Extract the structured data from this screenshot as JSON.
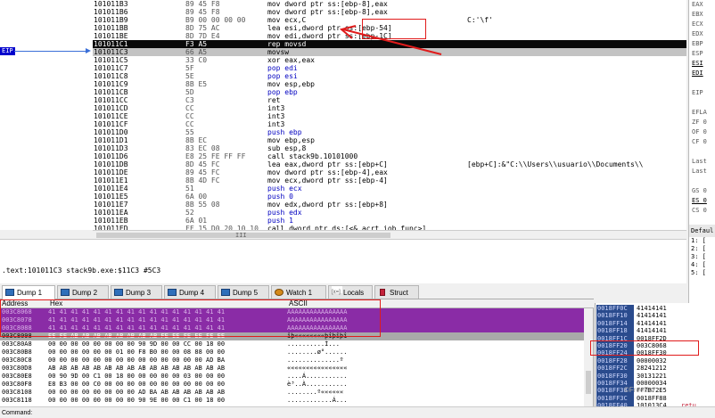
{
  "eip_label": "EIP",
  "disasm": [
    {
      "addr": "101011B3",
      "bytes": "89 45 F8",
      "instr": "mov dword ptr ss:[ebp-8],eax",
      "cmt": ""
    },
    {
      "addr": "101011B6",
      "bytes": "89 45 F8",
      "instr": "mov dword ptr ss:[ebp-8],eax",
      "cmt": ""
    },
    {
      "addr": "101011B9",
      "bytes": "B9 00 00 00 00",
      "instr": "mov ecx,C",
      "cmt": "C:'\\f'"
    },
    {
      "addr": "101011BB",
      "bytes": "8D 75 AC",
      "instr": "lea esi,dword ptr ss:[ebp-54]",
      "cmt": ""
    },
    {
      "addr": "101011BE",
      "bytes": "8D 7D E4",
      "instr": "mov edi,dword ptr ss:[ebp-1C]",
      "cmt": ""
    },
    {
      "addr": "101011C1",
      "bytes": "F3 A5",
      "instr": "rep movsd",
      "cmt": ""
    },
    {
      "addr": "101011C3",
      "bytes": "66 A5",
      "instr": "movsw",
      "cmt": ""
    },
    {
      "addr": "101011C5",
      "bytes": "33 C0",
      "instr": "xor eax,eax",
      "cmt": ""
    },
    {
      "addr": "101011C7",
      "bytes": "5F",
      "instr": "pop edi",
      "cmt": ""
    },
    {
      "addr": "101011C8",
      "bytes": "5E",
      "instr": "pop esi",
      "cmt": ""
    },
    {
      "addr": "101011C9",
      "bytes": "8B E5",
      "instr": "mov esp,ebp",
      "cmt": ""
    },
    {
      "addr": "101011CB",
      "bytes": "5D",
      "instr": "pop ebp",
      "cmt": ""
    },
    {
      "addr": "101011CC",
      "bytes": "C3",
      "instr": "ret",
      "cmt": ""
    },
    {
      "addr": "101011CD",
      "bytes": "CC",
      "instr": "int3",
      "cmt": ""
    },
    {
      "addr": "101011CE",
      "bytes": "CC",
      "instr": "int3",
      "cmt": ""
    },
    {
      "addr": "101011CF",
      "bytes": "CC",
      "instr": "int3",
      "cmt": ""
    },
    {
      "addr": "101011D0",
      "bytes": "55",
      "instr": "push ebp",
      "cmt": ""
    },
    {
      "addr": "101011D1",
      "bytes": "8B EC",
      "instr": "mov ebp,esp",
      "cmt": ""
    },
    {
      "addr": "101011D3",
      "bytes": "83 EC 08",
      "instr": "sub esp,8",
      "cmt": ""
    },
    {
      "addr": "101011D6",
      "bytes": "E8 25 FE FF FF",
      "instr": "call stack9b.10101000",
      "cmt": ""
    },
    {
      "addr": "101011DB",
      "bytes": "8D 45 FC",
      "instr": "lea eax,dword ptr ss:[ebp+C]",
      "cmt": "[ebp+C]:&\"C:\\\\Users\\\\usuario\\\\Documents\\\\"
    },
    {
      "addr": "101011DE",
      "bytes": "89 45 FC",
      "instr": "mov dword ptr ss:[ebp-4],eax",
      "cmt": ""
    },
    {
      "addr": "101011E1",
      "bytes": "8B 4D FC",
      "instr": "mov ecx,dword ptr ss:[ebp-4]",
      "cmt": ""
    },
    {
      "addr": "101011E4",
      "bytes": "51",
      "instr": "push ecx",
      "cmt": ""
    },
    {
      "addr": "101011E5",
      "bytes": "6A 00",
      "instr": "push 0",
      "cmt": ""
    },
    {
      "addr": "101011E7",
      "bytes": "8B 55 08",
      "instr": "mov edx,dword ptr ss:[ebp+8]",
      "cmt": ""
    },
    {
      "addr": "101011EA",
      "bytes": "52",
      "instr": "push edx",
      "cmt": ""
    },
    {
      "addr": "101011EB",
      "bytes": "6A 01",
      "instr": "push 1",
      "cmt": ""
    },
    {
      "addr": "101011ED",
      "bytes": "FF 15 D0 20 10 10",
      "instr": "call dword ptr ds:[<&_acrt_iob_func>]",
      "cmt": ""
    }
  ],
  "registers": [
    "EAX",
    "EBX",
    "ECX",
    "EDX",
    "EBP",
    "ESP",
    "ESI",
    "EDI",
    "",
    "EIP",
    "",
    "EFLA",
    "ZF 0",
    "OF 0",
    "CF 0",
    "",
    "Last",
    "Last",
    "",
    "GS 0",
    "ES 0",
    "CS 0",
    "",
    "x87r",
    "x87r"
  ],
  "def_panel": {
    "header": "Defaul",
    "lines": [
      "1: [",
      "2: [",
      "3: [",
      "4: [",
      "5: ["
    ]
  },
  "info_line": ".text:101011C3 stack9b.exe:$11C3 #5C3",
  "tabs": [
    {
      "label": "Dump 1",
      "icon": "dump-icon"
    },
    {
      "label": "Dump 2",
      "icon": "dump-icon"
    },
    {
      "label": "Dump 3",
      "icon": "dump-icon"
    },
    {
      "label": "Dump 4",
      "icon": "dump-icon"
    },
    {
      "label": "Dump 5",
      "icon": "dump-icon"
    },
    {
      "label": "Watch 1",
      "icon": "watch-icon"
    },
    {
      "label": "Locals",
      "icon": "locals-icon"
    },
    {
      "label": "Struct",
      "icon": "struct-icon"
    }
  ],
  "dump_header": {
    "address": "Address",
    "hex": "Hex",
    "ascii": "ASCII"
  },
  "dump_rows": [
    {
      "addr": "003C8068",
      "hex": "41 41 41 41 41 41 41 41 41 41 41 41 41 41 41 41",
      "ascii": "AAAAAAAAAAAAAAAA",
      "style": "hl"
    },
    {
      "addr": "003C8078",
      "hex": "41 41 41 41 41 41 41 41 41 41 41 41 41 41 41 41",
      "ascii": "AAAAAAAAAAAAAAAA",
      "style": "hl"
    },
    {
      "addr": "003C8088",
      "hex": "41 41 41 41 41 41 41 41 41 41 41 41 41 41 41 41",
      "ascii": "AAAAAAAAAAAAAAAA",
      "style": "hl"
    },
    {
      "addr": "003C8098",
      "hex": "EE FE AB AB AB AB AB AB AB AB FE EE FE EE FE EE",
      "ascii": "îþ««««««««þîþîþî",
      "style": "ef"
    },
    {
      "addr": "003C80A8",
      "hex": "00 00 00 00 00 00 00 00 90 9D 00 00 CC 00 18 00",
      "ascii": "..........Ì...",
      "style": ""
    },
    {
      "addr": "003C80B8",
      "hex": "00 00 00 00 00 00 01 00 F8 B0 00 00 08 88 00 00",
      "ascii": "........ø°......",
      "style": ""
    },
    {
      "addr": "003C80C8",
      "hex": "00 00 00 00 00 00 00 00 00 00 00 00 00 00 AD BA",
      "ascii": "..............­º",
      "style": ""
    },
    {
      "addr": "003C80D8",
      "hex": "AB AB AB AB AB AB AB AB AB AB AB AB AB AB AB AB",
      "ascii": "««««««««««««««««",
      "style": ""
    },
    {
      "addr": "003C80E8",
      "hex": "00 90 9D 00 C1 00 18 00 00 00 00 00 03 00 00 00",
      "ascii": "....Á...........",
      "style": ""
    },
    {
      "addr": "003C80F8",
      "hex": "E8 B3 00 00 C0 00 00 00 00 00 00 00 00 00 00 00",
      "ascii": "è³..À...........",
      "style": ""
    },
    {
      "addr": "003C8108",
      "hex": "00 00 00 00 00 00 00 00 AD BA AB AB AB AB AB AB",
      "ascii": "........­º««««««",
      "style": ""
    },
    {
      "addr": "003C8118",
      "hex": "00 00 00 00 00 00 00 00 90 9E 00 00 C1 00 18 00",
      "ascii": "............Á...",
      "style": ""
    }
  ],
  "stack_rows": [
    {
      "addr": "0018FF0C",
      "val": "41414141",
      "cmt": ""
    },
    {
      "addr": "0018FF10",
      "val": "41414141",
      "cmt": ""
    },
    {
      "addr": "0018FF14",
      "val": "41414141",
      "cmt": ""
    },
    {
      "addr": "0018FF18",
      "val": "41414141",
      "cmt": ""
    },
    {
      "addr": "0018FF1C",
      "val": "0018FF2D",
      "cmt": ""
    },
    {
      "addr": "0018FF20",
      "val": "003C8068",
      "cmt": ""
    },
    {
      "addr": "0018FF24",
      "val": "0018FF30",
      "cmt": ""
    },
    {
      "addr": "0018FF28",
      "val": "00000032",
      "cmt": ""
    },
    {
      "addr": "0018FF2C",
      "val": "28241212",
      "cmt": ""
    },
    {
      "addr": "0018FF30",
      "val": "30131221",
      "cmt": ""
    },
    {
      "addr": "0018FF34",
      "val": "00000034",
      "cmt": ""
    },
    {
      "addr": "0018FF38",
      "val": "FF7B72E5",
      "cmt": ""
    },
    {
      "addr": "0018FF3C",
      "val": "0018FF88",
      "cmt": ""
    },
    {
      "addr": "0018FF40",
      "val": "101013C4",
      "cmt": "retu"
    }
  ],
  "command_label": "Command:",
  "scroll_center": "III",
  "watermark": "©FreeBuf"
}
